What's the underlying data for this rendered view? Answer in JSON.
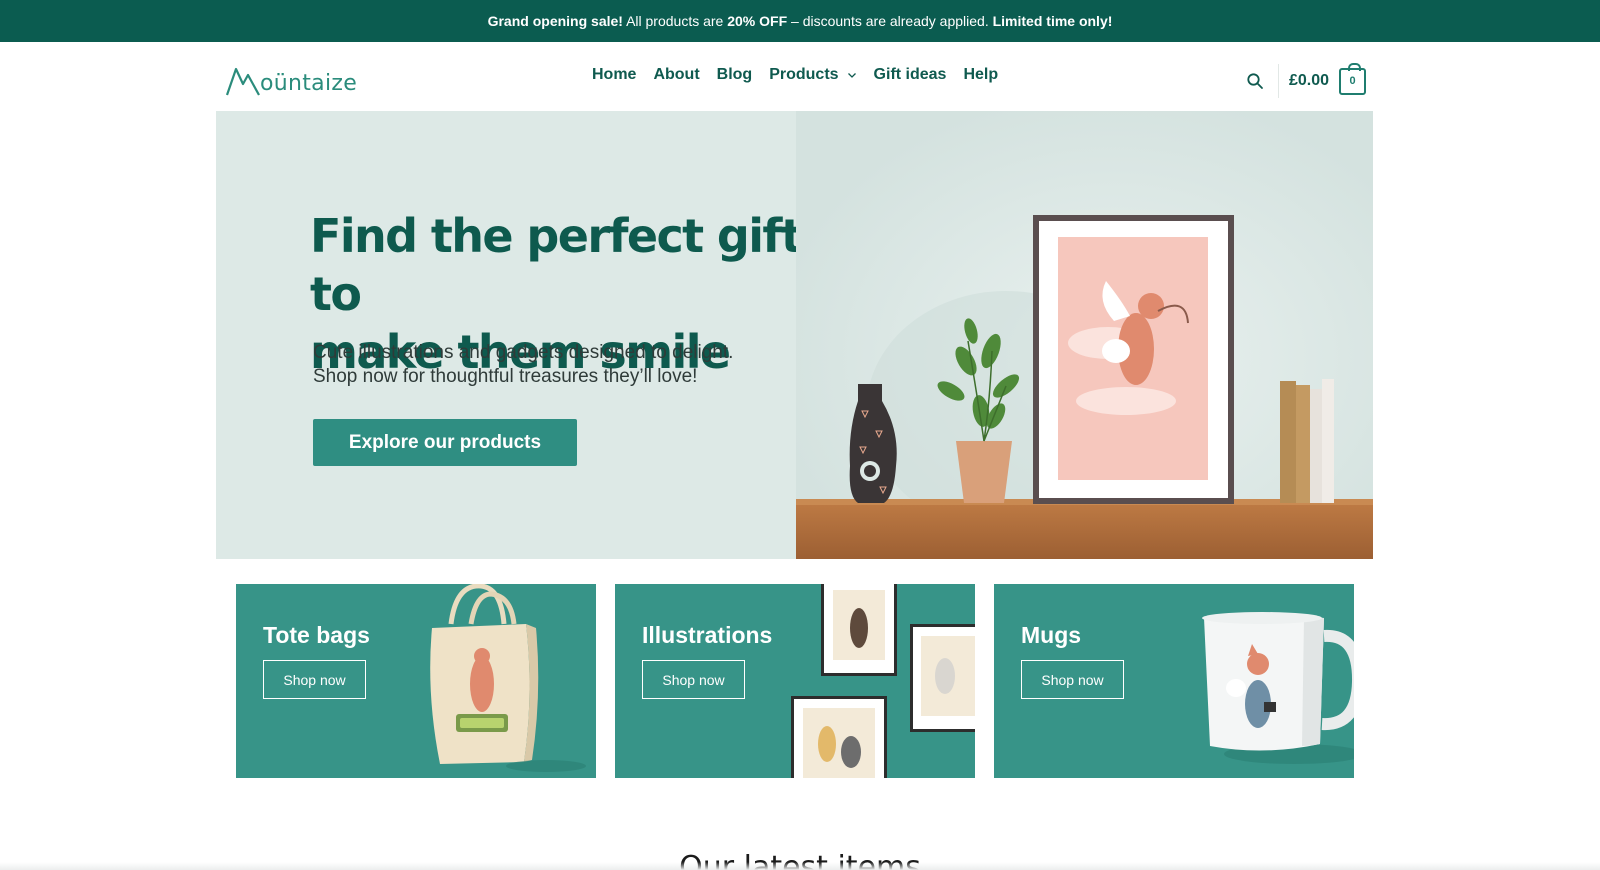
{
  "announcement": {
    "part1_bold": "Grand opening sale!",
    "part2": " All products are ",
    "part3_bold": "20% OFF",
    "part4": " – discounts are already applied. ",
    "part5_bold": "Limited time only!"
  },
  "header": {
    "logo_text": "oüntaize",
    "nav": [
      "Home",
      "About",
      "Blog",
      "Products",
      "Gift ideas",
      "Help"
    ],
    "cart_total": "£0.00",
    "cart_count": "0"
  },
  "hero": {
    "title_line1": "Find the perfect gift to",
    "title_line2": "make them smile",
    "subtitle_line1": "Cute illustrations and gadgets designed to delight.",
    "subtitle_line2": "Shop now for thoughtful treasures they’ll love!",
    "cta_label": "Explore our products"
  },
  "categories": [
    {
      "title": "Tote bags",
      "button": "Shop now"
    },
    {
      "title": "Illustrations",
      "button": "Shop now"
    },
    {
      "title": "Mugs",
      "button": "Shop now"
    }
  ],
  "latest_heading": "Our latest items",
  "colors": {
    "brand_dark": "#0b5c50",
    "brand_teal": "#379488",
    "hero_bg": "#dde9e6",
    "cta": "#2f8e82"
  },
  "icons": [
    "search-icon",
    "cart-icon",
    "chevron-down-icon",
    "logo-mountain-icon"
  ]
}
